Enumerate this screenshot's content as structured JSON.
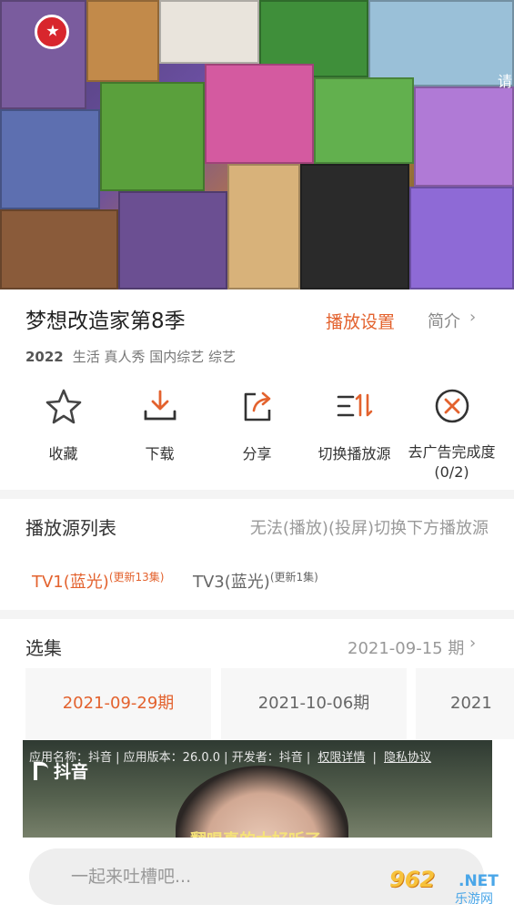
{
  "video": {
    "edge_text": "请"
  },
  "show": {
    "title": "梦想改造家第8季",
    "play_settings": "播放设置",
    "intro": "简介",
    "year": "2022",
    "tags": "生活 真人秀 国内综艺 综艺"
  },
  "actions": [
    {
      "label": "收藏",
      "icon": "star-icon"
    },
    {
      "label": "下载",
      "icon": "download-icon"
    },
    {
      "label": "分享",
      "icon": "share-icon"
    },
    {
      "label": "切换播放源",
      "icon": "switch-source-icon"
    },
    {
      "label": "去广告完成度",
      "sub": "(0/2)",
      "icon": "no-ads-icon"
    }
  ],
  "sources": {
    "title": "播放源列表",
    "hint": "无法(播放)(投屏)切换下方播放源",
    "items": [
      {
        "name": "TV1(蓝光)",
        "update": "(更新13集)",
        "active": true
      },
      {
        "name": "TV3(蓝光)",
        "update": "(更新1集)",
        "active": false
      }
    ]
  },
  "episodes": {
    "title": "选集",
    "current": "2021-09-15 期",
    "items": [
      "2021-09-29期",
      "2021-10-06期",
      "2021"
    ]
  },
  "ad": {
    "app_name_label": "应用名称：抖音",
    "version": "应用版本：26.0.0",
    "developer": "开发者：抖音",
    "permissions": "权限详情",
    "privacy": "隐私协议",
    "brand": "抖音",
    "subtitle": "翻唱真的太好听了"
  },
  "comment": {
    "placeholder": "一起来吐槽吧..."
  },
  "watermark": {
    "num": "962",
    "net": ".NET",
    "cn": "乐游网"
  },
  "colors": {
    "accent": "#e3622e"
  }
}
